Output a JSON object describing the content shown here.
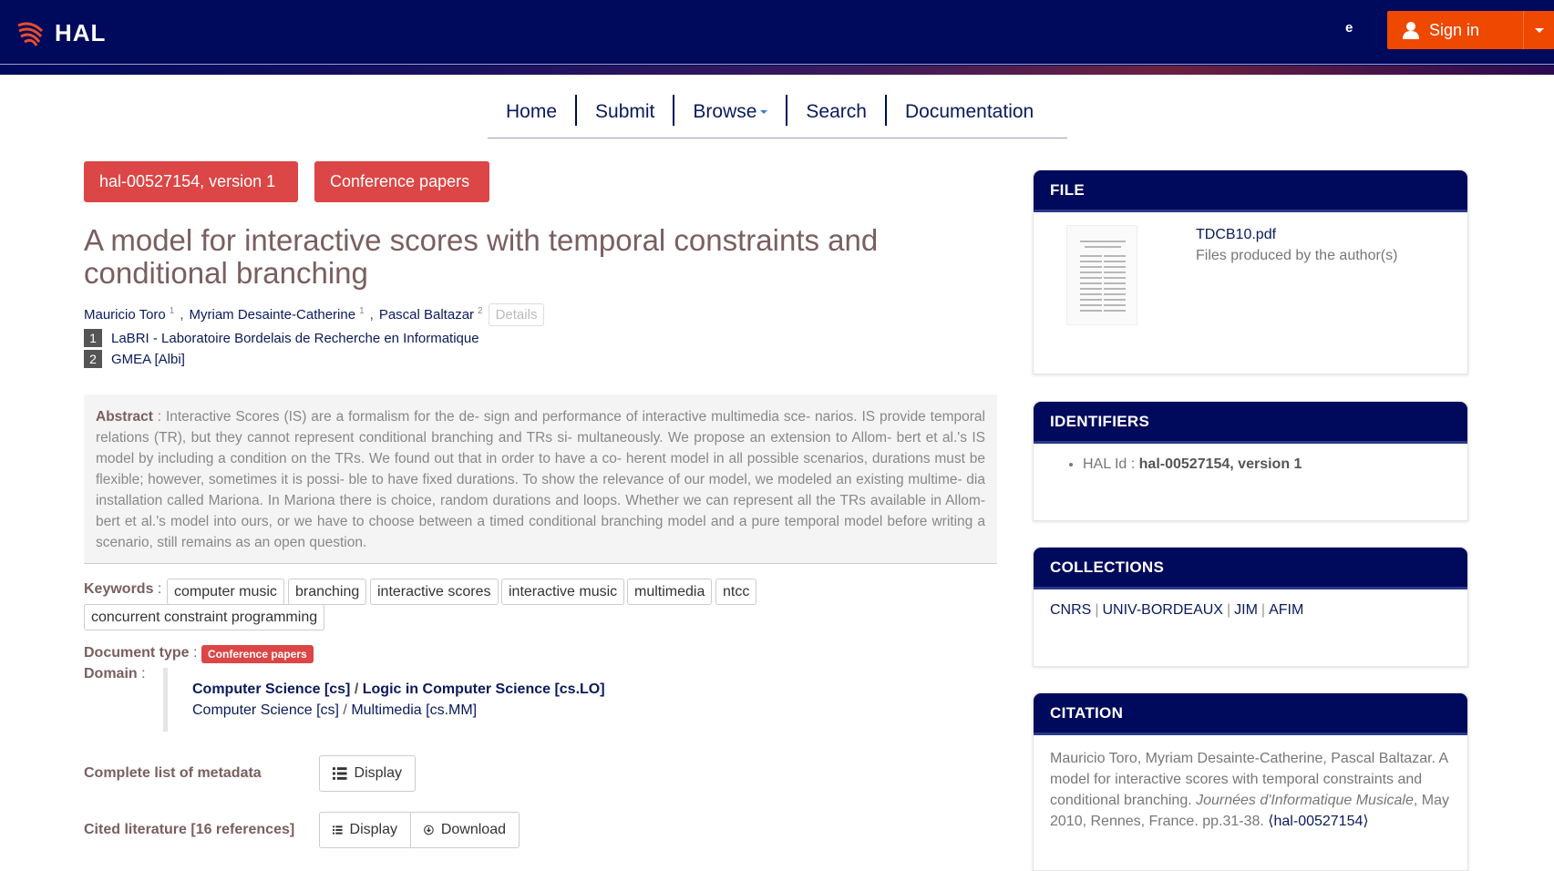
{
  "header": {
    "logo_text": "HAL",
    "lang": "e",
    "signin_label": "Sign in"
  },
  "nav": {
    "items": [
      "Home",
      "Submit",
      "Browse",
      "Search",
      "Documentation"
    ]
  },
  "record": {
    "id_badge": "hal-00527154, version 1",
    "type_badge": "Conference papers",
    "title": "A model for interactive scores with temporal constraints and conditional branching",
    "authors": [
      {
        "name": "Mauricio Toro",
        "aff": "1"
      },
      {
        "name": "Myriam Desainte-Catherine",
        "aff": "1"
      },
      {
        "name": "Pascal Baltazar",
        "aff": "2"
      }
    ],
    "author_sep": ",",
    "details_label": "Details",
    "affiliations": [
      {
        "num": "1",
        "name": "LaBRI - Laboratoire Bordelais de Recherche en Informatique"
      },
      {
        "num": "2",
        "name": "GMEA [Albi]"
      }
    ],
    "abstract_label": "Abstract",
    "abstract_text": " : Interactive Scores (IS) are a formalism for the de- sign and performance of interactive multimedia sce- narios. IS provide temporal relations (TR), but they cannot represent conditional branching and TRs si- multaneously. We propose an extension to Allom- bert et al.'s IS model by including a condition on the TRs. We found out that in order to have a co- herent model in all possible scenarios, durations must be flexible; however, sometimes it is possi- ble to have fixed durations. To show the relevance of our model, we modeled an existing multime- dia installation called Mariona. In Mariona there is choice, random durations and loops. Whether we can represent all the TRs available in Allom- bert et al.'s model into ours, or we have to choose between a timed conditional branching model and a pure temporal model before writing a scenario, still remains as an open question.",
    "keywords_label": "Keywords",
    "keywords": [
      "computer music",
      "branching",
      "interactive scores",
      "interactive music",
      "multimedia",
      "ntcc",
      "concurrent constraint programming"
    ],
    "doctype_label": "Document type",
    "doctype_value": "Conference papers",
    "domain_label": "Domain",
    "domain_lines": [
      {
        "a": "Computer Science [cs]",
        "b": "Logic in Computer Science [cs.LO]"
      },
      {
        "a": "Computer Science [cs]",
        "b": "Multimedia [cs.MM]"
      }
    ],
    "metadata_label": "Complete list of metadata",
    "metadata_btn": "Display",
    "cited_label": "Cited literature [16 references]",
    "cited_display": "Display",
    "cited_download": "Download",
    "colon": " :"
  },
  "sidebar": {
    "file": {
      "title": "FILE",
      "name": "TDCB10.pdf",
      "note": "Files produced by the author(s)"
    },
    "identifiers": {
      "title": "IDENTIFIERS",
      "label": "HAL Id : ",
      "value": "hal-00527154, version 1"
    },
    "collections": {
      "title": "COLLECTIONS",
      "items": [
        "CNRS",
        "UNIV-BORDEAUX",
        "JIM",
        "AFIM"
      ]
    },
    "citation": {
      "title": "CITATION",
      "text_before": "Mauricio Toro, Myriam Desainte-Catherine, Pascal Baltazar. A model for interactive scores with temporal constraints and conditional branching. ",
      "venue": "Journées d'Informatique Musicale",
      "text_after": ", May 2010, Rennes, France. pp.31-38. ",
      "hal_link": "⟨hal-00527154⟩"
    }
  }
}
